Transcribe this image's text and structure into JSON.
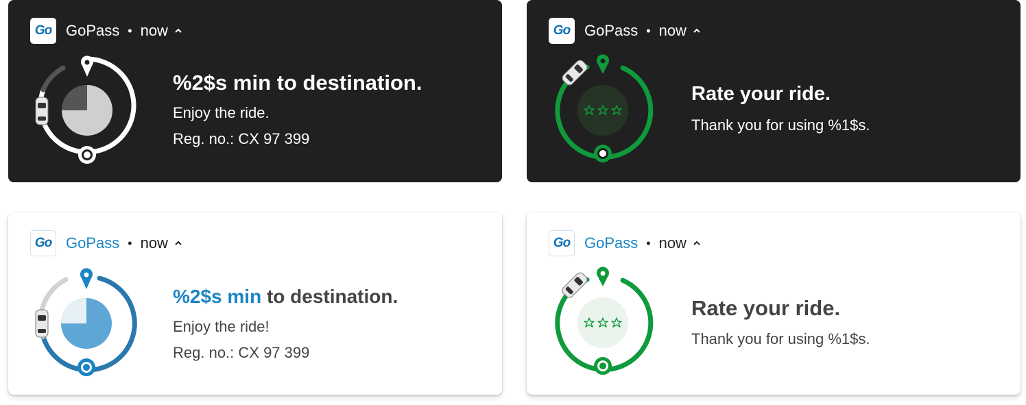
{
  "notifications": [
    {
      "theme": "dark",
      "app_name": "GoPass",
      "separator": "•",
      "time": "now",
      "logo_text": "Go",
      "title": "%2$s min to destination.",
      "line1": "Enjoy the ride.",
      "line2": "Reg. no.: CX 97 399",
      "progress_fraction": 0.75
    },
    {
      "theme": "dark",
      "app_name": "GoPass",
      "separator": "•",
      "time": "now",
      "logo_text": "Go",
      "title": "Rate your ride.",
      "line1": "Thank you for using %1$s.",
      "stars": 3
    },
    {
      "theme": "light",
      "app_name": "GoPass",
      "separator": "•",
      "time": "now",
      "logo_text": "Go",
      "title_highlight": "%2$s min",
      "title_rest": " to destination.",
      "line1": "Enjoy the ride!",
      "line2": "Reg. no.: CX 97 399",
      "progress_fraction": 0.75
    },
    {
      "theme": "light",
      "app_name": "GoPass",
      "separator": "•",
      "time": "now",
      "logo_text": "Go",
      "title": "Rate your ride.",
      "line1": "Thank you for using %1$s.",
      "stars": 3
    }
  ],
  "colors": {
    "brand_blue": "#1a85c4",
    "green": "#0f9a3c",
    "dark_bg": "#202020"
  },
  "icons": {
    "expand": "chevron-up-icon",
    "vehicle": "car-icon",
    "pin": "location-pin-icon",
    "destination": "destination-ring-icon",
    "rating": "star-outline-icon"
  }
}
